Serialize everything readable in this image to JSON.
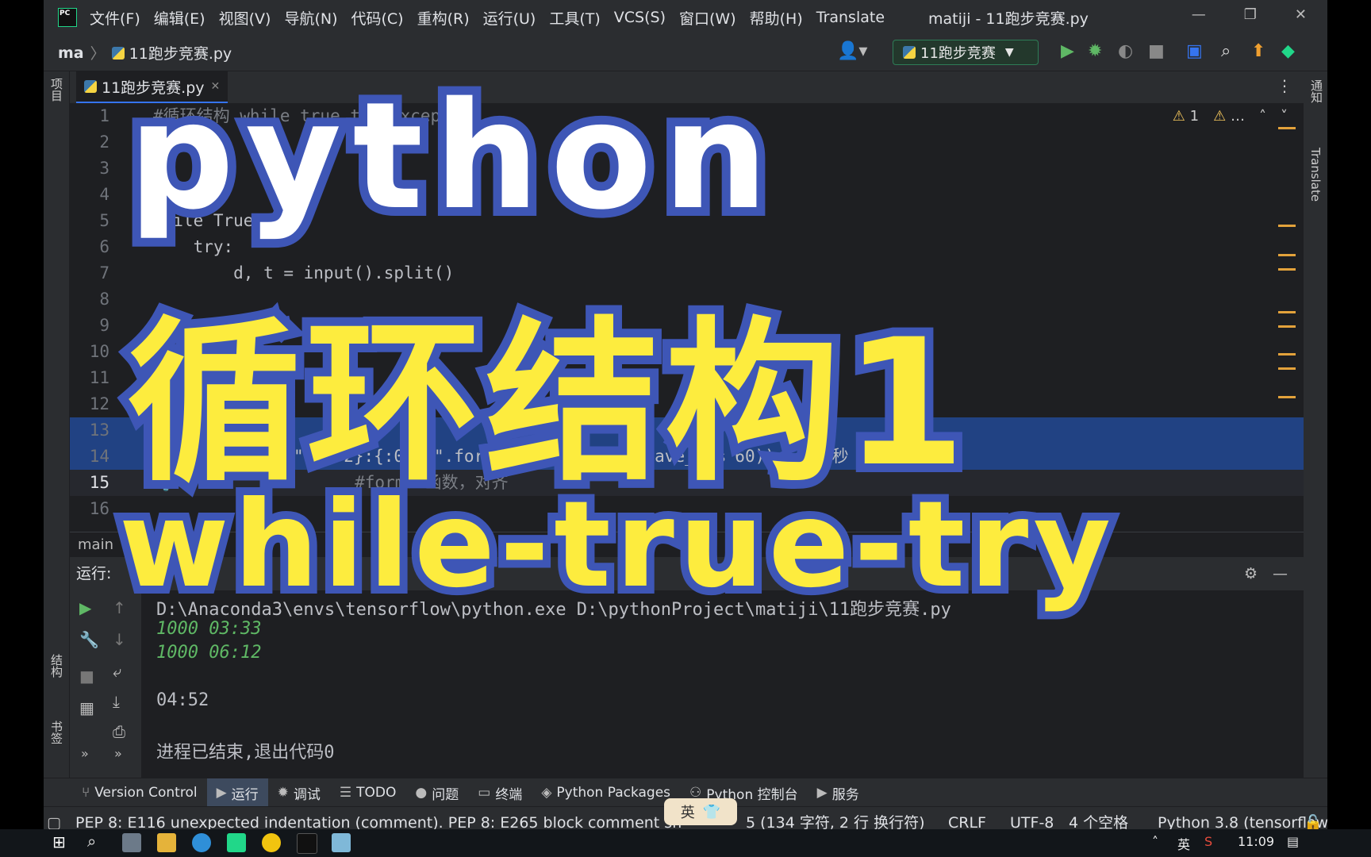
{
  "app": {
    "menu": [
      "文件(F)",
      "编辑(E)",
      "视图(V)",
      "导航(N)",
      "代码(C)",
      "重构(R)",
      "运行(U)",
      "工具(T)",
      "VCS(S)",
      "窗口(W)",
      "帮助(H)",
      "Translate"
    ],
    "window_title": "matiji - 11跑步竞赛.py",
    "logo_text": "PC"
  },
  "nav": {
    "project": "ma",
    "file": "11跑步竞赛.py",
    "run_config": "11跑步竞赛"
  },
  "left_panels": {
    "project": "项目",
    "structure": "结构",
    "bookmarks": "书签"
  },
  "right_panels": {
    "notifications": "通知",
    "translate": "Translate"
  },
  "editor": {
    "tab_name": "11跑步竞赛.py",
    "warnings_a": "1",
    "warnings_b": "…",
    "lines": [
      {
        "n": "1",
        "text": "#循环结构 while true try except"
      },
      {
        "n": "2",
        "text": ""
      },
      {
        "n": "3",
        "text": ""
      },
      {
        "n": "4",
        "text": ""
      },
      {
        "n": "5",
        "text": "while True:"
      },
      {
        "n": "6",
        "text": "    try:"
      },
      {
        "n": "7",
        "text": "        d, t = input().split()"
      },
      {
        "n": "8",
        "text": ""
      },
      {
        "n": "9",
        "text": "        d, t = map(int, [d, t])"
      },
      {
        "n": "10",
        "text": ""
      },
      {
        "n": "11",
        "text": ""
      },
      {
        "n": "12",
        "text": ""
      },
      {
        "n": "13",
        "text": ""
      },
      {
        "n": "14",
        "text": "        print(\"{:0>2}:{:0>2}\".format(ave_t // 60, ave_t % 60))  #分:秒"
      },
      {
        "n": "15",
        "text": "        #format函数，对齐"
      },
      {
        "n": "16",
        "text": ""
      }
    ],
    "breadcrumb": "main"
  },
  "run": {
    "label": "运行:",
    "console": [
      {
        "text": "D:\\Anaconda3\\envs\\tensorflow\\python.exe D:\\pythonProject\\matiji\\11跑步竞赛.py",
        "kind": "cmd"
      },
      {
        "text": "1000 03:33",
        "kind": "in"
      },
      {
        "text": "1000 06:12",
        "kind": "in"
      },
      {
        "text": "",
        "kind": "out"
      },
      {
        "text": "04:52",
        "kind": "out"
      },
      {
        "text": "",
        "kind": "out"
      },
      {
        "text": "进程已结束,退出代码0",
        "kind": "out"
      }
    ]
  },
  "bottom_tabs": [
    "Version Control",
    "运行",
    "调试",
    "TODO",
    "问题",
    "终端",
    "Python Packages",
    "Python 控制台",
    "服务"
  ],
  "status": {
    "message": "PEP 8: E116 unexpected indentation (comment). PEP 8: E265 block comment sh",
    "position": "5 (134 字符, 2 行 换行符)",
    "line_sep": "CRLF",
    "encoding": "UTF-8",
    "indent": "4 个空格",
    "interpreter": "Python 3.8 (tensorflow)"
  },
  "ime": {
    "lang": "英"
  },
  "taskbar": {
    "tray_lang": "英",
    "time": "11:09"
  },
  "overlay": {
    "line1": "python",
    "line2": "循环结构1",
    "line3": "while-true-try"
  }
}
